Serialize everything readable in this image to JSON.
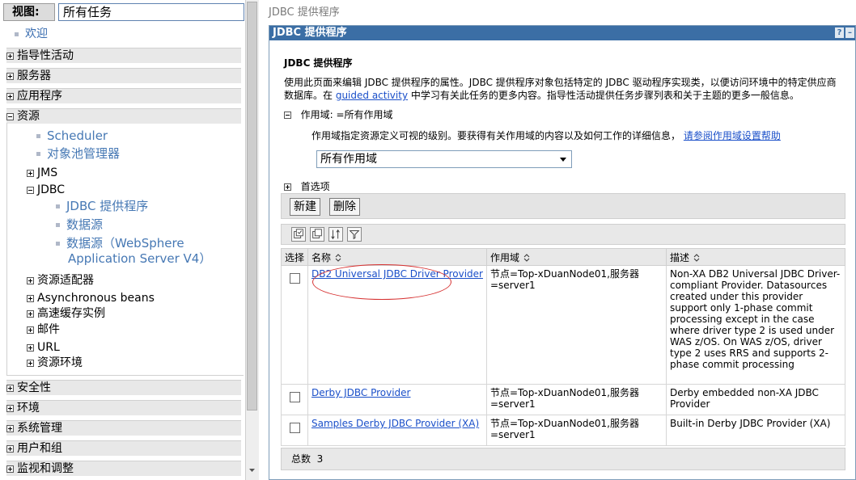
{
  "nav": {
    "view_label": "视图:",
    "view_value": "所有任务",
    "welcome": "欢迎",
    "categories": [
      "指导性活动",
      "服务器",
      "应用程序",
      "资源"
    ],
    "resources_children": {
      "scheduler": "Scheduler",
      "object_pool": "对象池管理器",
      "jms": "JMS",
      "jdbc": "JDBC",
      "jdbc_providers": "JDBC 提供程序",
      "data_sources": "数据源",
      "data_sources_v4_line1": "数据源（WebSphere",
      "data_sources_v4_line2": "Application Server V4）",
      "resource_adapters": "资源适配器",
      "async_beans": "Asynchronous beans",
      "cache": "高速缓存实例",
      "mail": "邮件",
      "url": "URL",
      "res_env": "资源环境"
    },
    "bottom_categories": [
      "安全性",
      "环境",
      "系统管理",
      "用户和组",
      "监视和调整"
    ]
  },
  "breadcrumb": "JDBC 提供程序",
  "portlet": {
    "title": "JDBC 提供程序",
    "help_btn": "?",
    "min_btn": "–",
    "heading": "JDBC 提供程序",
    "desc_part1": "使用此页面来编辑 JDBC 提供程序的属性。JDBC 提供程序对象包括特定的 JDBC 驱动程序实现类，以便访问环境中的特定供应商",
    "desc_part2": "数据库。在 ",
    "desc_link": "guided activity",
    "desc_part3": " 中学习有关此任务的更多内容。指导性活动提供任务步骤列表和关于主题的更多一般信息。",
    "scope_label": "作用域: =所有作用域",
    "scope_desc": "作用域指定资源定义可视的级别。要获得有关作用域的内容以及如何工作的详细信息，",
    "scope_help_link": "请参阅作用域设置帮助",
    "scope_select": "所有作用域",
    "prefs_label": "首选项",
    "new_btn": "新建",
    "delete_btn": "删除",
    "table": {
      "headers": [
        "选择",
        "名称",
        "作用域",
        "描述"
      ],
      "rows": [
        {
          "name": "DB2 Universal JDBC Driver Provider",
          "scope": "节点=Top-xDuanNode01,服务器=server1",
          "desc": "Non-XA DB2 Universal JDBC Driver-compliant Provider. Datasources created under this provider support only 1-phase commit processing except in the case where driver type 2 is used under WAS z/OS. On WAS z/OS, driver type 2 uses RRS and supports 2-phase commit processing"
        },
        {
          "name": "Derby JDBC Provider",
          "scope": "节点=Top-xDuanNode01,服务器=server1",
          "desc": "Derby embedded non-XA JDBC Provider"
        },
        {
          "name": "Samples Derby JDBC Provider (XA)",
          "scope": "节点=Top-xDuanNode01,服务器=server1",
          "desc": "Built-in Derby JDBC Provider (XA)"
        }
      ]
    },
    "total_label": "总数",
    "total_value": "3"
  },
  "colors": {
    "title_bar": "#3b6ea5",
    "link": "#1a4fc9",
    "highlight_circle": "#d63030"
  }
}
